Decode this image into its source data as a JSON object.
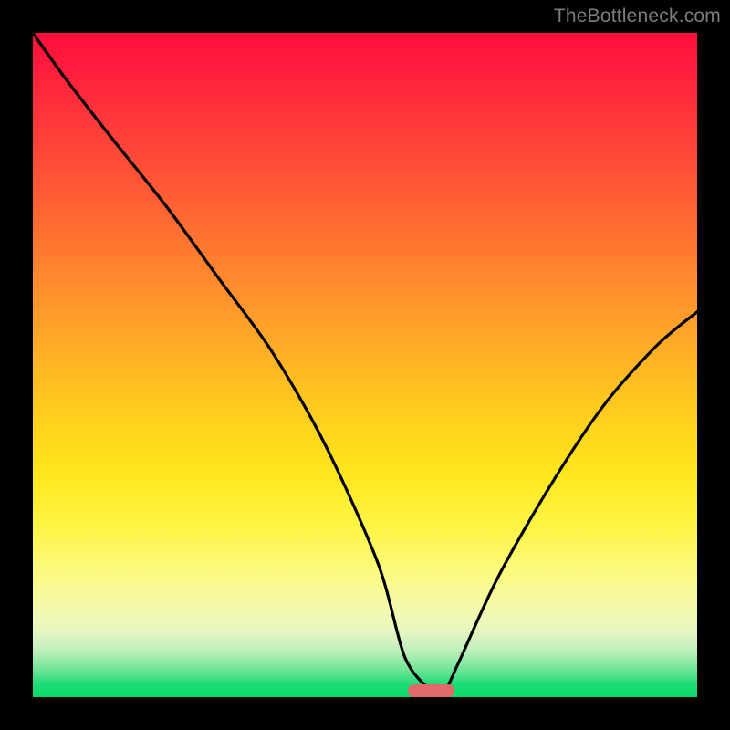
{
  "watermark": "TheBottleneck.com",
  "chart_data": {
    "type": "line",
    "title": "",
    "xlabel": "",
    "ylabel": "",
    "xlim": [
      0,
      100
    ],
    "ylim": [
      0,
      100
    ],
    "grid": false,
    "background_gradient": {
      "direction": "vertical",
      "stops": [
        {
          "pos": 0,
          "color": "#ff0d3a"
        },
        {
          "pos": 50,
          "color": "#ffc61f"
        },
        {
          "pos": 80,
          "color": "#fbfb88"
        },
        {
          "pos": 100,
          "color": "#08d968"
        }
      ]
    },
    "series": [
      {
        "name": "bottleneck-curve",
        "color": "#000000",
        "x": [
          0,
          5,
          12,
          20,
          28,
          36,
          44,
          52,
          56,
          60,
          62,
          64,
          70,
          78,
          86,
          94,
          100
        ],
        "y": [
          100,
          93,
          84,
          74,
          63,
          52,
          38,
          20,
          6,
          1,
          1,
          5,
          18,
          32,
          44,
          53,
          58
        ]
      }
    ],
    "marker": {
      "name": "optimal-point",
      "x_center": 60,
      "y": 0,
      "width_pct": 7,
      "color": "#e26a6a"
    }
  }
}
